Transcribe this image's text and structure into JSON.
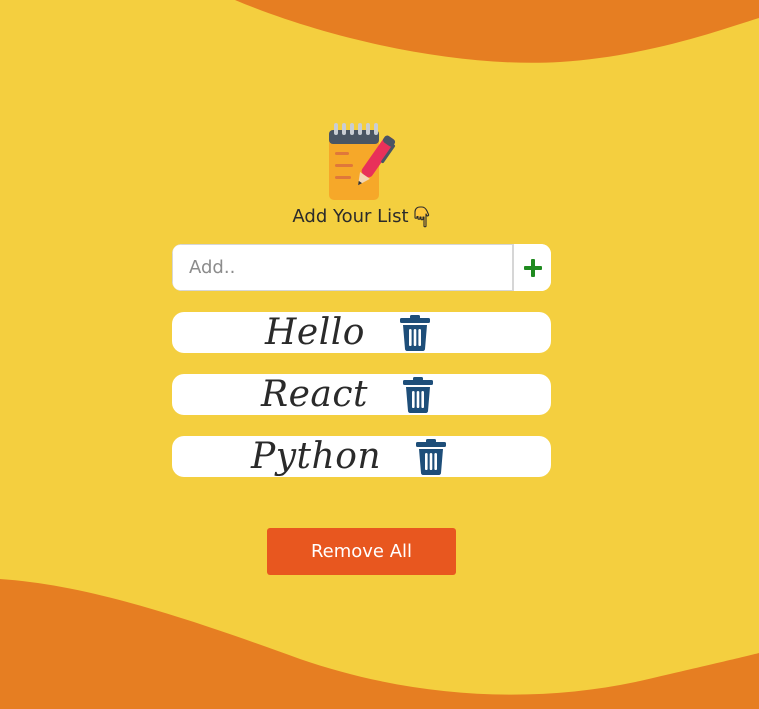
{
  "app": {
    "heading": "Add Your List",
    "input": {
      "placeholder": "Add..",
      "value": ""
    },
    "add_button_icon": "plus-icon",
    "items": [
      {
        "label": "Hello"
      },
      {
        "label": "React"
      },
      {
        "label": "Python"
      }
    ],
    "remove_all_label": "Remove All"
  },
  "colors": {
    "background": "#f4cf3f",
    "wave": "#e67e22",
    "remove_button": "#e8571f",
    "trash": "#1e4e79",
    "plus": "#1f8a1f"
  },
  "icons": {
    "logo": "notepad-pen-icon",
    "pointer": "hand-pointing-down-icon",
    "delete": "trash-icon"
  }
}
